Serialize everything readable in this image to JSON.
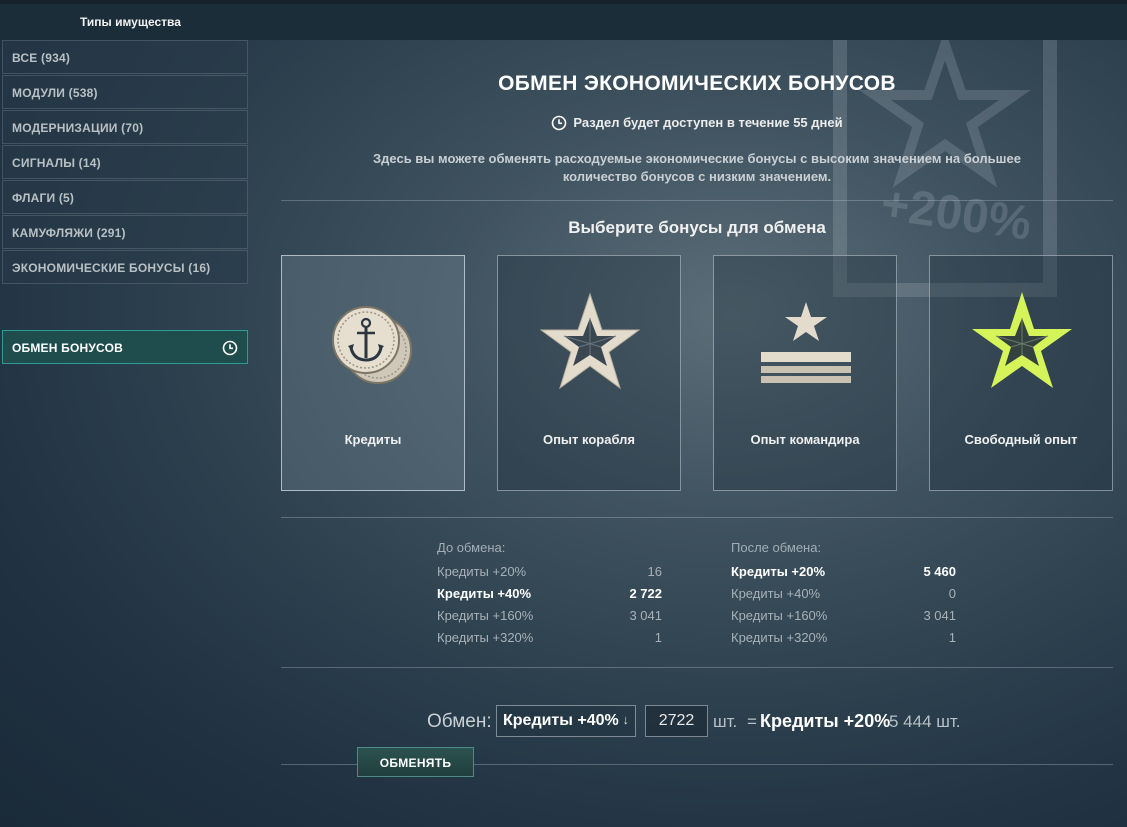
{
  "topbar": {
    "title": "Типы имущества"
  },
  "sidebar": {
    "items": [
      {
        "label": "ВСЕ (934)"
      },
      {
        "label": "МОДУЛИ (538)"
      },
      {
        "label": "МОДЕРНИЗАЦИИ (70)"
      },
      {
        "label": "СИГНАЛЫ (14)"
      },
      {
        "label": "ФЛАГИ (5)"
      },
      {
        "label": "КАМУФЛЯЖИ (291)"
      },
      {
        "label": "ЭКОНОМИЧЕСКИЕ БОНУСЫ (16)"
      }
    ],
    "active_item": {
      "label": "ОБМЕН БОНУСОВ",
      "icon": "clock-icon"
    }
  },
  "watermark": {
    "text": "+200%",
    "icon": "star-icon"
  },
  "main": {
    "title": "ОБМЕН ЭКОНОМИЧЕСКИХ БОНУСОВ",
    "availability": "Раздел будет доступен в течение 55 дней",
    "description": "Здесь вы можете обменять расходуемые экономические бонусы с высоким значением на большее количество бонусов с низким значением.",
    "choose_title": "Выберите бонусы для обмена",
    "cards": [
      {
        "label": "Кредиты",
        "icon": "coins-icon",
        "selected": true
      },
      {
        "label": "Опыт корабля",
        "icon": "star-icon",
        "selected": false
      },
      {
        "label": "Опыт командира",
        "icon": "commander-rank-icon",
        "selected": false
      },
      {
        "label": "Свободный опыт",
        "icon": "free-xp-star-icon",
        "selected": false,
        "accent": "#d4f45a"
      }
    ],
    "before": {
      "heading": "До обмена:",
      "rows": [
        {
          "name": "Кредиты +20%",
          "value": "16",
          "bold": false
        },
        {
          "name": "Кредиты +40%",
          "value": "2 722",
          "bold": true
        },
        {
          "name": "Кредиты +160%",
          "value": "3 041",
          "bold": false
        },
        {
          "name": "Кредиты +320%",
          "value": "1",
          "bold": false
        }
      ]
    },
    "after": {
      "heading": "После обмена:",
      "rows": [
        {
          "name": "Кредиты +20%",
          "value": "5 460",
          "bold": true
        },
        {
          "name": "Кредиты +40%",
          "value": "0",
          "bold": false
        },
        {
          "name": "Кредиты +160%",
          "value": "3 041",
          "bold": false
        },
        {
          "name": "Кредиты +320%",
          "value": "1",
          "bold": false
        }
      ]
    },
    "exchange": {
      "label": "Обмен:",
      "selected_bonus": "Кредиты +40%",
      "quantity": "2722",
      "unit": "шт.",
      "equals": "=",
      "target_bonus": "Кредиты +20%",
      "result": "5 444 шт."
    },
    "button_label": "ОБМЕНЯТЬ"
  }
}
